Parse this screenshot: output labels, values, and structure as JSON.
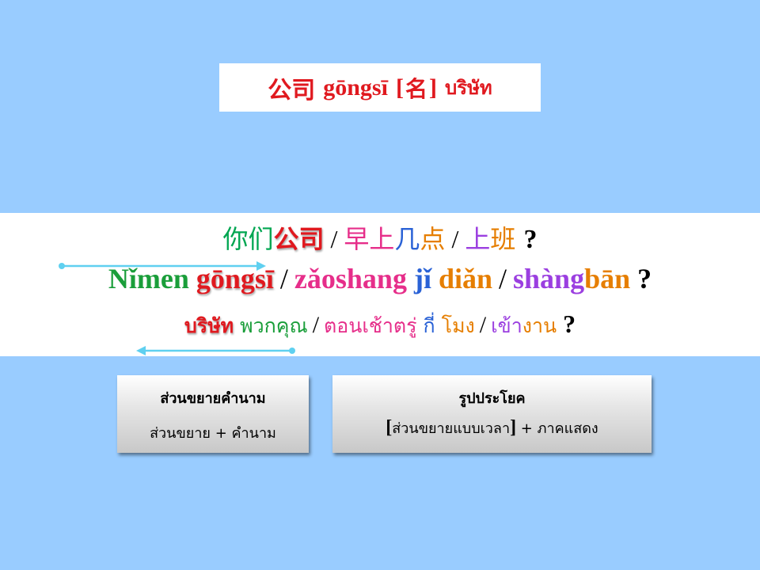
{
  "title": {
    "hanzi": "公司",
    "pinyin": "gōngsī",
    "pos_open": "[",
    "pos": "名",
    "pos_close": "]",
    "thai": "บริษัท"
  },
  "sentence": {
    "hanzi": {
      "w1": "你们",
      "w2": "公司",
      "sep1": "/",
      "w3": "早上",
      "w4": "几",
      "w5": "点",
      "sep2": "/",
      "w6": "上",
      "w7": "班",
      "q": "?"
    },
    "pinyin": {
      "w1": "Nǐmen",
      "w2": "gōngsī",
      "sep1": "/",
      "w3": "zǎoshang",
      "w4": "jǐ",
      "w5": "diǎn",
      "sep2": "/",
      "w6": "shàng",
      "w7": "bān",
      "q": "?"
    },
    "thai": {
      "w1": "บริษัท",
      "w2": "พวกคุณ",
      "sep1": "/",
      "w3": "ตอนเช้าตรู่",
      "w4": "กี่",
      "w5": "โมง",
      "sep2": "/",
      "w6": "เข้า",
      "w7": "งาน",
      "q": "?"
    }
  },
  "cards": {
    "modifier": {
      "title": "ส่วนขยายคำนาม",
      "body": "ส่วนขยาย + คำนาม"
    },
    "sentence_pattern": {
      "title": "รูปประโยค",
      "bracket_open": "[",
      "bracket_text": "ส่วนขยายแบบเวลา",
      "bracket_close": "]",
      "rest": "+ ภาคแสดง"
    }
  },
  "colors": {
    "background": "#99ccff",
    "red": "#e0191f",
    "green": "#00a651",
    "magenta": "#e62e8a",
    "blue": "#2a62d6",
    "orange": "#e67e00",
    "purple": "#9b3fe0",
    "arrow": "#5fd0f0"
  }
}
